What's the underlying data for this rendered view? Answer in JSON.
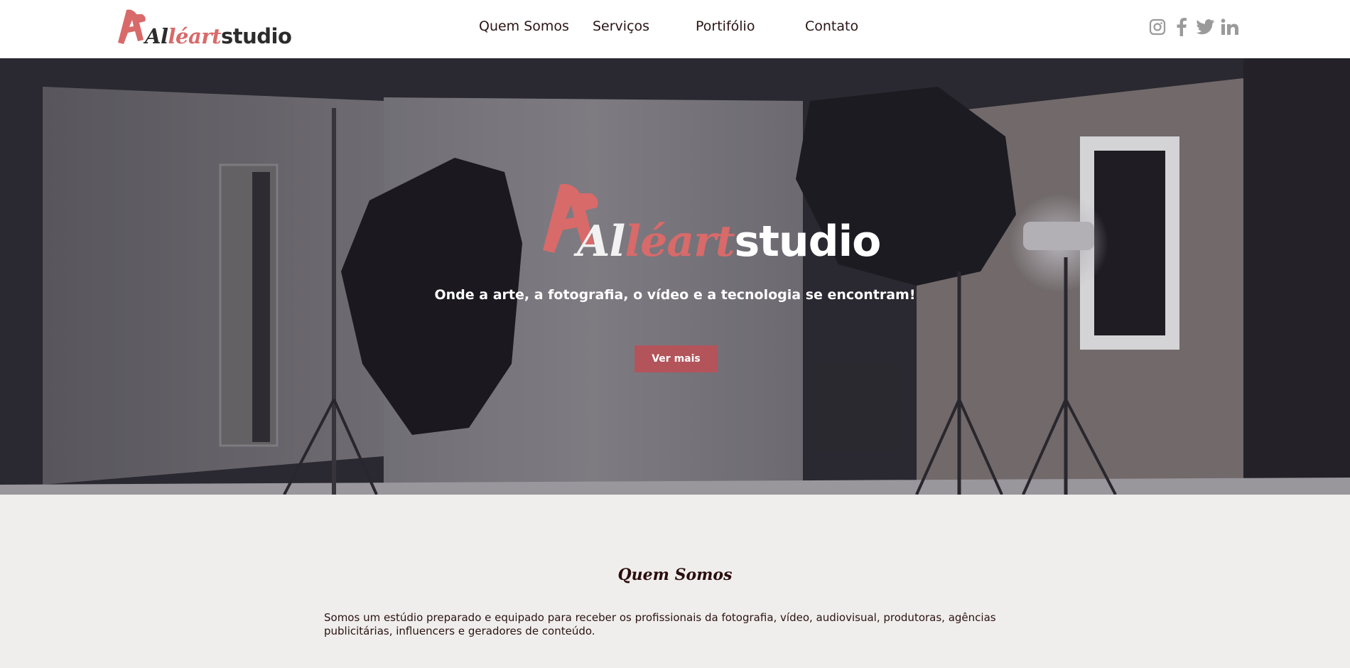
{
  "brand": {
    "logo_script_dark": "Al",
    "logo_script_red": "léart",
    "logo_word": "studio",
    "accent_color": "#d86a6a",
    "button_color": "#b3545a"
  },
  "nav": {
    "items": [
      {
        "label": "Quem Somos"
      },
      {
        "label": "Serviços"
      },
      {
        "label": "Portifólio"
      },
      {
        "label": "Contato"
      }
    ]
  },
  "social": {
    "icons": [
      "instagram-icon",
      "facebook-icon",
      "twitter-icon",
      "linkedin-icon"
    ]
  },
  "hero": {
    "tagline": "Onde a arte, a fotografia, o vídeo e a tecnologia se encontram!",
    "cta_label": "Ver mais"
  },
  "about": {
    "title": "Quem Somos",
    "paragraph": "Somos um estúdio preparado e equipado para receber os profissionais da fotografia, vídeo, audiovisual, produtoras, agências publicitárias, influencers e geradores de conteúdo."
  }
}
